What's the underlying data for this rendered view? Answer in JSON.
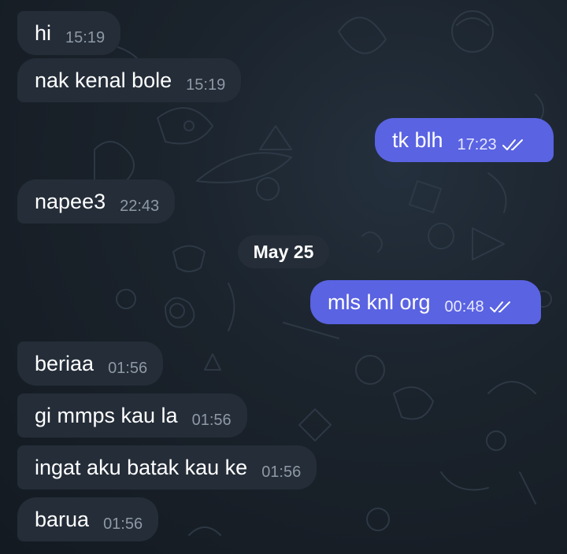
{
  "chat": {
    "date_separator": "May 25",
    "messages": [
      {
        "text": "hi",
        "time": "15:19",
        "direction": "incoming"
      },
      {
        "text": "nak kenal bole",
        "time": "15:19",
        "direction": "incoming"
      },
      {
        "text": "tk blh",
        "time": "17:23",
        "direction": "outgoing",
        "status_icon": "double-check-icon"
      },
      {
        "text": "napee3",
        "time": "22:43",
        "direction": "incoming"
      },
      {
        "text": "mls knl org",
        "time": "00:48",
        "direction": "outgoing",
        "status_icon": "double-check-icon"
      },
      {
        "text": "beriaa",
        "time": "01:56",
        "direction": "incoming"
      },
      {
        "text": "gi mmps kau la",
        "time": "01:56",
        "direction": "incoming"
      },
      {
        "text": "ingat aku batak kau ke",
        "time": "01:56",
        "direction": "incoming"
      },
      {
        "text": "barua",
        "time": "01:56",
        "direction": "incoming"
      }
    ]
  },
  "colors": {
    "background": "#1a222b",
    "incoming_bubble": "#242d38",
    "outgoing_bubble": "#5a63e2",
    "timestamp_incoming": "#8e99a6",
    "timestamp_outgoing": "#e6e8ff"
  }
}
